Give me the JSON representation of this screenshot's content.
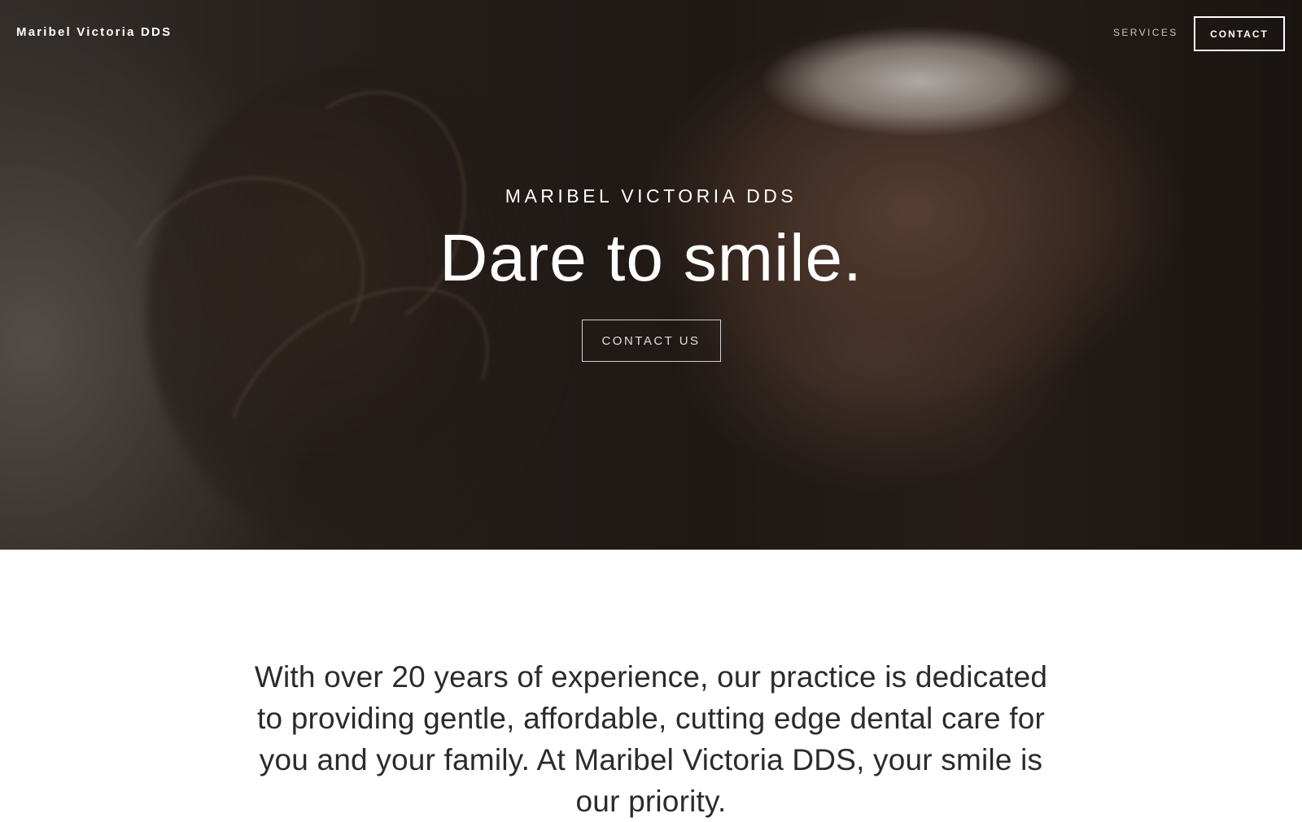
{
  "header": {
    "site_title": "Maribel Victoria DDS",
    "nav": {
      "services_label": "SERVICES",
      "contact_label": "CONTACT"
    }
  },
  "hero": {
    "kicker": "MARIBEL VICTORIA DDS",
    "heading": "Dare to smile.",
    "button_label": "CONTACT US",
    "background": "smiling-woman-photo"
  },
  "intro": {
    "text": "With over 20 years of experience, our practice is dedicated to providing gentle, affordable, cutting edge dental care for you and your family. At Maribel Victoria DDS, your smile is our priority."
  },
  "colors": {
    "hero_overlay": "#221b18",
    "text_light": "#ffffff",
    "text_dark": "#2b2b2b",
    "page_background": "#ffffff"
  }
}
